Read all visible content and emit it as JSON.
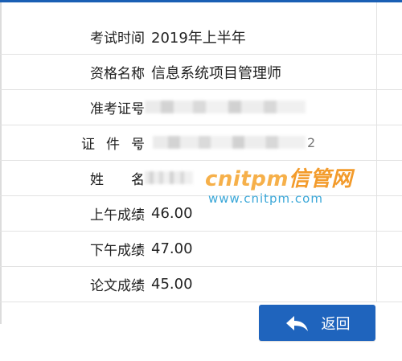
{
  "rows": [
    {
      "label": "考试时间",
      "value": "2019年上半年"
    },
    {
      "label": "资格名称",
      "value": "信息系统项目管理师"
    },
    {
      "label": "准考证号",
      "value": ""
    },
    {
      "label": "证 件 号",
      "value": "2"
    },
    {
      "label": "姓 名",
      "value": ""
    },
    {
      "label": "上午成绩",
      "value": "46.00"
    },
    {
      "label": "下午成绩",
      "value": "47.00"
    },
    {
      "label": "论文成绩",
      "value": "45.00"
    }
  ],
  "colon": "：",
  "watermark": {
    "brand": "cnitpm",
    "brand_cn": "信管网",
    "url": "www.cnitpm.com"
  },
  "back_button": {
    "label": "返回",
    "icon": "back-arrow-icon"
  },
  "colors": {
    "accent": "#1f64bd",
    "watermark_orange": "#f6b04a",
    "watermark_blue": "#3aa7d8"
  }
}
